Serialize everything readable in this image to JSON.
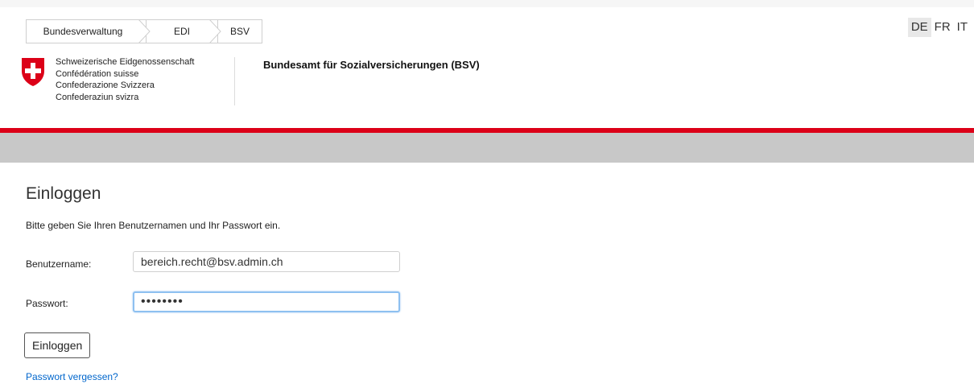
{
  "breadcrumb": {
    "items": [
      {
        "label": "Bundesverwaltung"
      },
      {
        "label": "EDI"
      },
      {
        "label": "BSV"
      }
    ]
  },
  "language": {
    "options": [
      "DE",
      "FR",
      "IT"
    ],
    "active": "DE"
  },
  "header": {
    "confederation_lines": [
      "Schweizerische Eidgenossenschaft",
      "Confédération suisse",
      "Confederazione Svizzera",
      "Confederaziun svizra"
    ],
    "office_name": "Bundesamt für Sozialversicherungen (BSV)",
    "crest_icon": "swiss-cross-icon"
  },
  "colors": {
    "accent_red": "#dc0018",
    "grey_bar": "#c8c8c8",
    "link_blue": "#0066cc",
    "focus_blue": "#8ec0f0"
  },
  "login": {
    "title": "Einloggen",
    "intro": "Bitte geben Sie Ihren Benutzernamen und Ihr Passwort ein.",
    "username_label": "Benutzername:",
    "username_value": "bereich.recht@bsv.admin.ch",
    "password_label": "Passwort:",
    "password_masked": "••••••••",
    "submit_label": "Einloggen",
    "forgot_link": "Passwort vergessen?"
  }
}
